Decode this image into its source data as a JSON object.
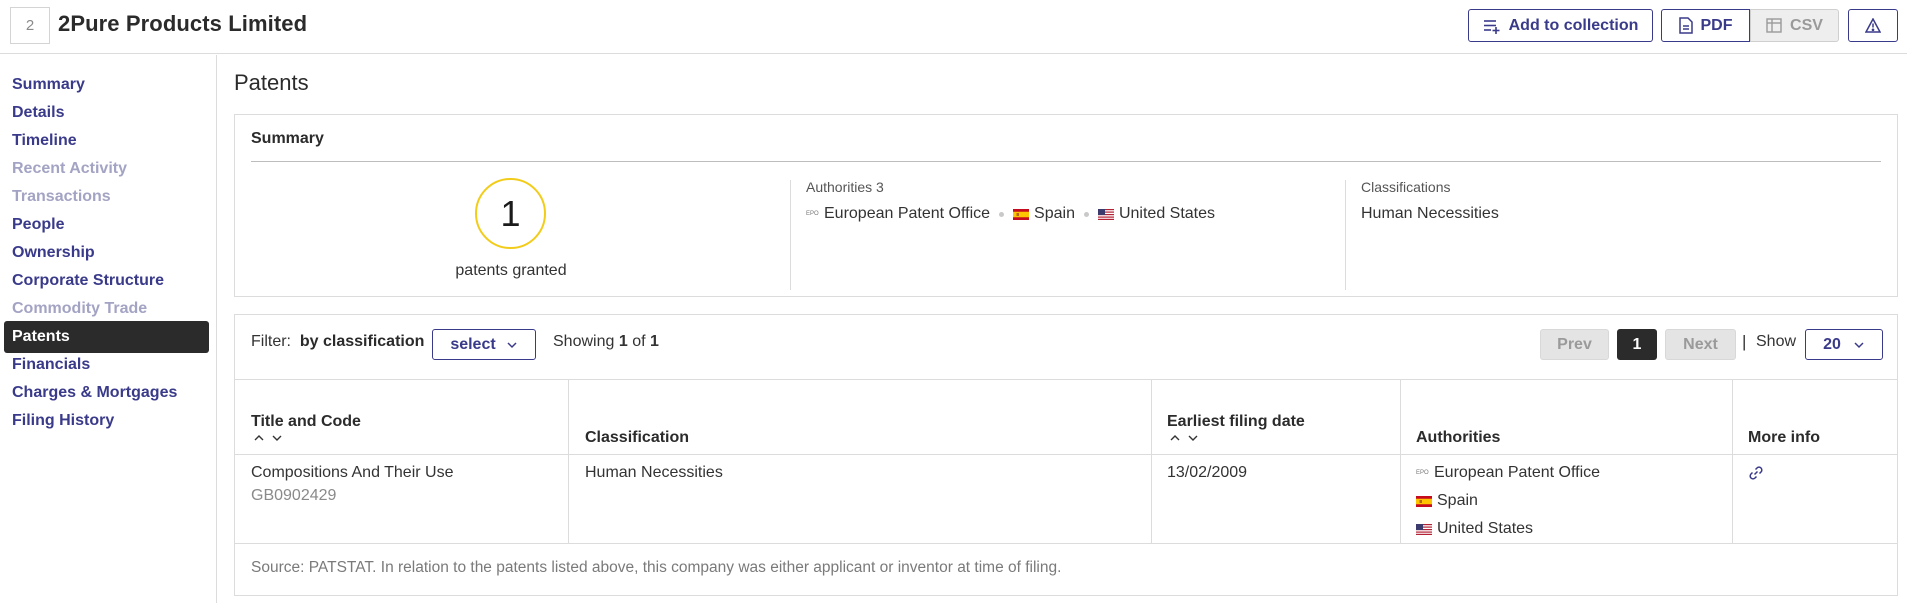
{
  "header": {
    "logo_text": "2",
    "company_name": "2Pure Products Limited",
    "add_to_collection_label": "Add to collection",
    "pdf_label": "PDF",
    "csv_label": "CSV",
    "icons": {
      "collection": "playlist-add-icon",
      "pdf": "document-icon",
      "csv": "table-icon",
      "report": "warning-triangle-icon"
    }
  },
  "sidebar": {
    "items": [
      {
        "label": "Summary",
        "state": "link"
      },
      {
        "label": "Details",
        "state": "link"
      },
      {
        "label": "Timeline",
        "state": "link"
      },
      {
        "label": "Recent Activity",
        "state": "muted"
      },
      {
        "label": "Transactions",
        "state": "muted"
      },
      {
        "label": "People",
        "state": "link"
      },
      {
        "label": "Ownership",
        "state": "link"
      },
      {
        "label": "Corporate Structure",
        "state": "link"
      },
      {
        "label": "Commodity Trade",
        "state": "muted"
      },
      {
        "label": "Patents",
        "state": "active"
      },
      {
        "label": "Financials",
        "state": "link"
      },
      {
        "label": "Charges & Mortgages",
        "state": "link"
      },
      {
        "label": "Filing History",
        "state": "link"
      }
    ]
  },
  "main": {
    "title": "Patents",
    "summary": {
      "heading": "Summary",
      "granted_count": "1",
      "granted_label": "patents granted",
      "authorities_label": "Authorities 3",
      "authorities": [
        {
          "name": "European Patent Office",
          "flag": "epo"
        },
        {
          "name": "Spain",
          "flag": "es"
        },
        {
          "name": "United States",
          "flag": "us"
        }
      ],
      "classifications_label": "Classifications",
      "classifications_value": "Human Necessities"
    },
    "filter": {
      "label": "Filter:",
      "by_label": "by classification",
      "select_label": "select",
      "showing_prefix": "Showing",
      "showing_from": "1",
      "showing_of": "of",
      "showing_total": "1"
    },
    "pagination": {
      "prev": "Prev",
      "current": "1",
      "next": "Next",
      "separator": "|",
      "show_label": "Show",
      "per_page": "20"
    },
    "table": {
      "columns": [
        "Title and Code",
        "Classification",
        "Earliest filing date",
        "Authorities",
        "More info"
      ],
      "rows": [
        {
          "title": "Compositions And Their Use",
          "code": "GB0902429",
          "classification": "Human Necessities",
          "filing_date": "13/02/2009",
          "authorities": [
            "European Patent Office",
            "Spain",
            "United States"
          ],
          "more_info_icon": "link-icon"
        }
      ],
      "source_note": "Source: PATSTAT. In relation to the patents listed above, this company was either applicant or inventor at time of filing."
    },
    "colors": {
      "accent": "#3a3a8a",
      "active_nav": "#2b2b2b",
      "muted_nav": "#a3a3c4",
      "granted_ring": "#f2cc1a"
    }
  }
}
